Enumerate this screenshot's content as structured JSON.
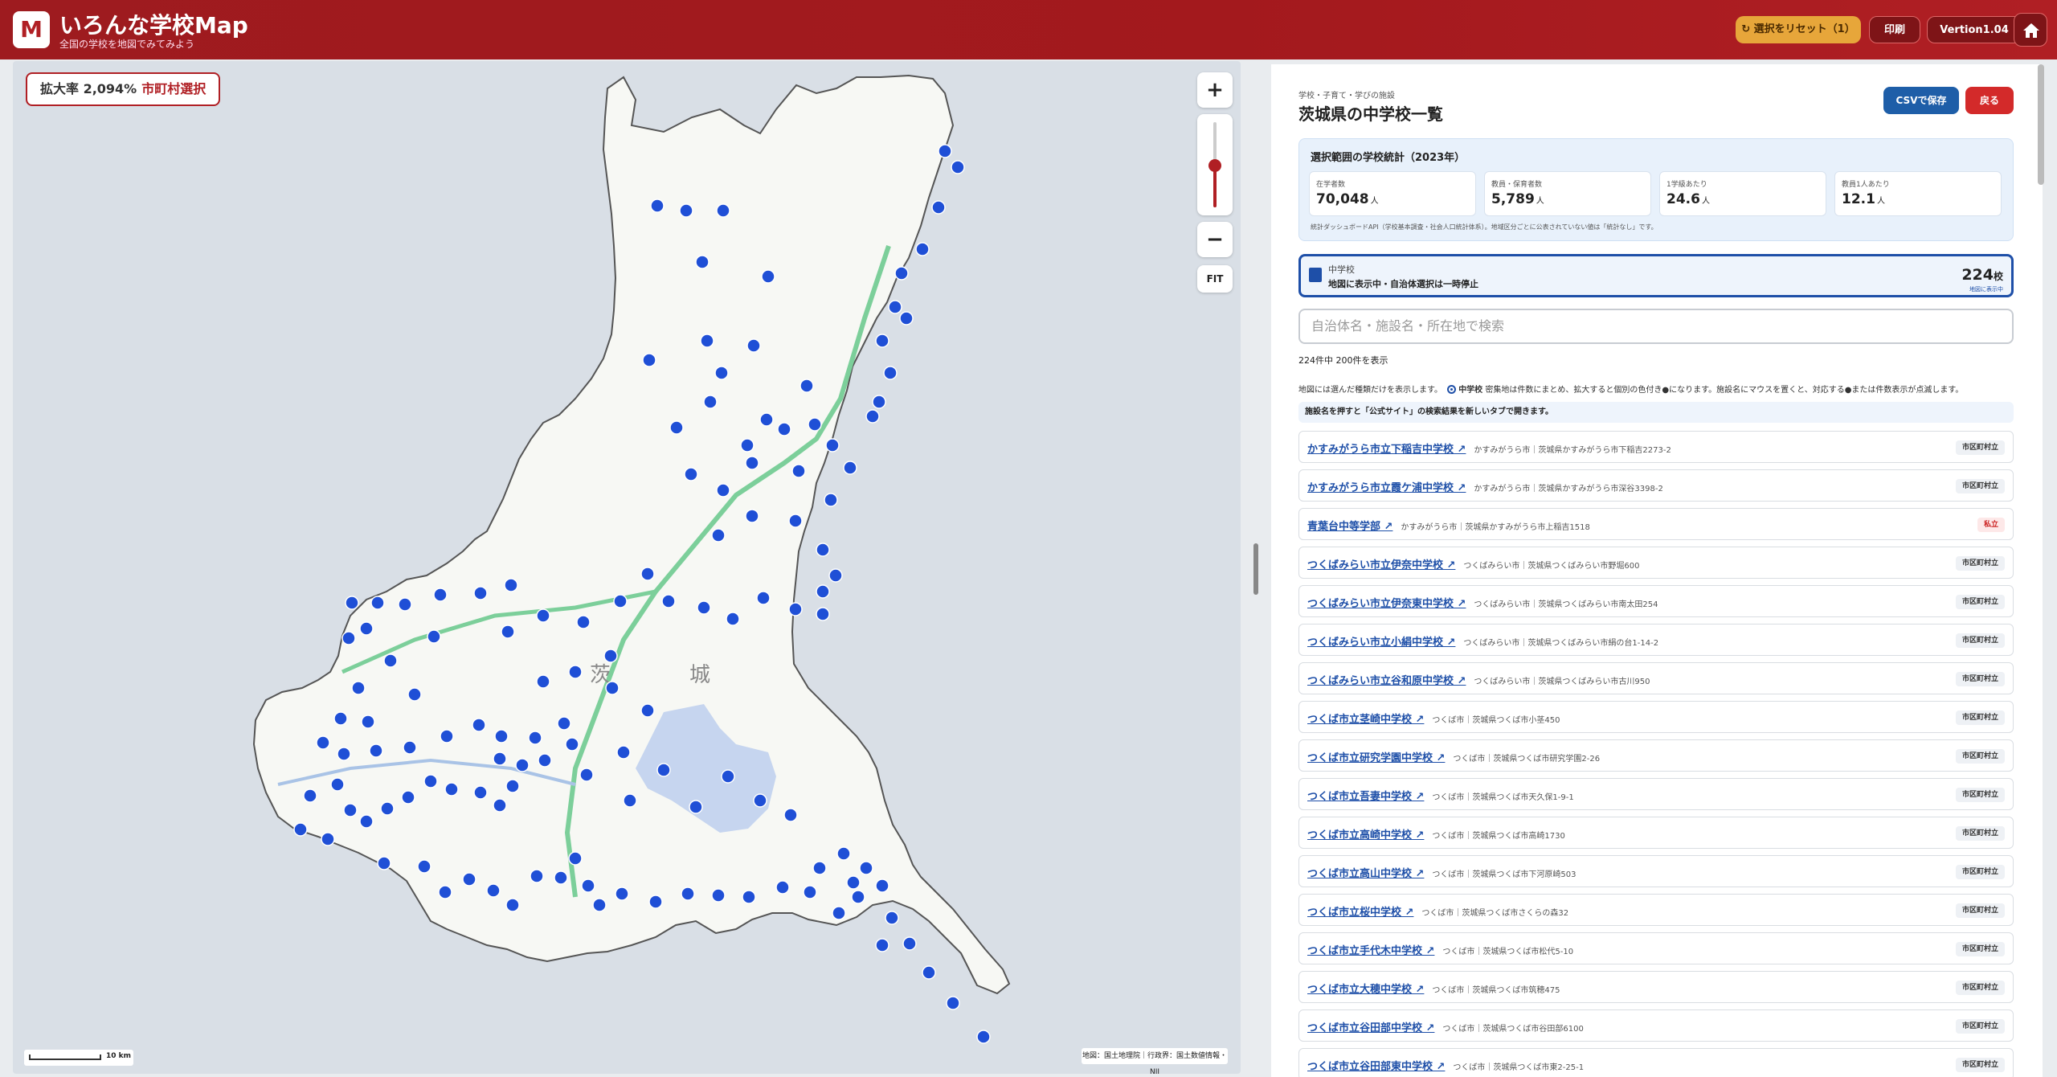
{
  "header": {
    "logo": "M",
    "title": "いろんな学校Map",
    "subtitle": "全国の学校を地図でみてみよう",
    "reset_label": "↻ 選択をリセット（1）",
    "print_label": "印刷",
    "version_label": "Vertion1.04"
  },
  "map": {
    "zoom_text": "拡大率 2,094%",
    "select_text": "市町村選択",
    "zoom_in": "+",
    "zoom_out": "−",
    "fit": "FIT",
    "scale_label": "10 km",
    "attribution": "地図：国土地理院｜行政界：国土数値情報・NII",
    "region_labels": [
      "茨",
      "城"
    ],
    "marker_color": "#1f4fd6",
    "region_fill": "#f7f8f4"
  },
  "panel": {
    "category": "学校・子育て・学びの施設",
    "title": "茨城県の中学校一覧",
    "csv_label": "CSVで保存",
    "back_label": "戻る",
    "stats_title": "選択範囲の学校統計（2023年）",
    "stats": [
      {
        "label": "在学者数",
        "value": "70,048",
        "unit": "人"
      },
      {
        "label": "教員・保育者数",
        "value": "5,789",
        "unit": "人"
      },
      {
        "label": "1学級あたり",
        "value": "24.6",
        "unit": "人"
      },
      {
        "label": "教員1人あたり",
        "value": "12.1",
        "unit": "人"
      }
    ],
    "stats_note": "統計ダッシュボードAPI（学校基本調査・社会人口統計体系）。地域区分ごとに公表されていない値は「統計なし」です。",
    "type_card": {
      "name": "中学校",
      "status": "地図に表示中・自治体選択は一時停止",
      "count": "224",
      "unit": "校",
      "link": "地図に表示中"
    },
    "search_placeholder": "自治体名・施設名・所在地で検索",
    "shown_count": "224件中 200件を表示",
    "legend_prefix": "地図には選んだ種類だけを表示します。",
    "legend_type": "中学校",
    "legend_suffix": "密集地は件数にまとめ、拡大すると個別の色付き●になります。施設名にマウスを置くと、対応する●または件数表示が点滅します。",
    "tip": "施設名を押すと「公式サイト」の検索結果を新しいタブで開きます。",
    "schools": [
      {
        "name": "かすみがうら市立下稲吉中学校 ↗",
        "address": "かすみがうら市｜茨城県かすみがうら市下稲吉2273-2",
        "badge": "市区町村立"
      },
      {
        "name": "かすみがうら市立霞ケ浦中学校 ↗",
        "address": "かすみがうら市｜茨城県かすみがうら市深谷3398-2",
        "badge": "市区町村立"
      },
      {
        "name": "青葉台中等学部 ↗",
        "address": "かすみがうら市｜茨城県かすみがうら市上稲吉1518",
        "badge": "私立"
      },
      {
        "name": "つくばみらい市立伊奈中学校 ↗",
        "address": "つくばみらい市｜茨城県つくばみらい市野堀600",
        "badge": "市区町村立"
      },
      {
        "name": "つくばみらい市立伊奈東中学校 ↗",
        "address": "つくばみらい市｜茨城県つくばみらい市南太田254",
        "badge": "市区町村立"
      },
      {
        "name": "つくばみらい市立小絹中学校 ↗",
        "address": "つくばみらい市｜茨城県つくばみらい市絹の台1-14-2",
        "badge": "市区町村立"
      },
      {
        "name": "つくばみらい市立谷和原中学校 ↗",
        "address": "つくばみらい市｜茨城県つくばみらい市古川950",
        "badge": "市区町村立"
      },
      {
        "name": "つくば市立茎崎中学校 ↗",
        "address": "つくば市｜茨城県つくば市小茎450",
        "badge": "市区町村立"
      },
      {
        "name": "つくば市立研究学園中学校 ↗",
        "address": "つくば市｜茨城県つくば市研究学園2-26",
        "badge": "市区町村立"
      },
      {
        "name": "つくば市立吾妻中学校 ↗",
        "address": "つくば市｜茨城県つくば市天久保1-9-1",
        "badge": "市区町村立"
      },
      {
        "name": "つくば市立高崎中学校 ↗",
        "address": "つくば市｜茨城県つくば市高崎1730",
        "badge": "市区町村立"
      },
      {
        "name": "つくば市立高山中学校 ↗",
        "address": "つくば市｜茨城県つくば市下河原崎503",
        "badge": "市区町村立"
      },
      {
        "name": "つくば市立桜中学校 ↗",
        "address": "つくば市｜茨城県つくば市さくらの森32",
        "badge": "市区町村立"
      },
      {
        "name": "つくば市立手代木中学校 ↗",
        "address": "つくば市｜茨城県つくば市松代5-10",
        "badge": "市区町村立"
      },
      {
        "name": "つくば市立大穂中学校 ↗",
        "address": "つくば市｜茨城県つくば市筑穂475",
        "badge": "市区町村立"
      },
      {
        "name": "つくば市立谷田部中学校 ↗",
        "address": "つくば市｜茨城県つくば市谷田部6100",
        "badge": "市区町村立"
      },
      {
        "name": "つくば市立谷田部東中学校 ↗",
        "address": "つくば市｜茨城県つくば市東2-25-1",
        "badge": "市区町村立"
      }
    ]
  }
}
